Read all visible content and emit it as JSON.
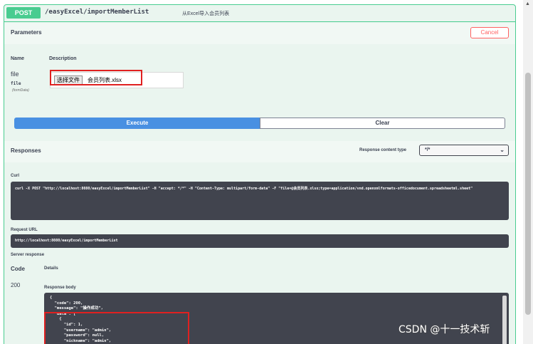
{
  "summary": {
    "method": "POST",
    "path": "/easyExcel/importMemberList",
    "description": "从Excel导入会员列表"
  },
  "parameters": {
    "title": "Parameters",
    "cancel_label": "Cancel",
    "col_name": "Name",
    "col_description": "Description",
    "param": {
      "name": "file",
      "type": "file",
      "in": "(formData)",
      "choose_label": "选择文件",
      "file_name": "会员列表.xlsx"
    },
    "execute_label": "Execute",
    "clear_label": "Clear"
  },
  "responses": {
    "title": "Responses",
    "content_type_label": "Response content type",
    "content_type_value": "*/*",
    "curl_label": "Curl",
    "curl_text": "curl -X POST \"http://localhost:8080/easyExcel/importMemberList\" -H \"accept: */*\" -H \"Content-Type: multipart/form-data\" -F \"file=@会员列表.xlsx;type=application/vnd.openxmlformats-officedocument.spreadsheetml.sheet\"",
    "request_url_label": "Request URL",
    "request_url": "http://localhost:8080/easyExcel/importMemberList",
    "server_response_label": "Server response",
    "code_header": "Code",
    "details_header": "Details",
    "code": "200",
    "response_body_label": "Response body",
    "response_body": "{\n  \"code\": 200,\n  \"message\": \"操作成功\",\n  \"data\": [\n    {\n      \"id\": 1,\n      \"username\": \"admin\",\n      \"password\": null,\n      \"nickname\": \"admin\","
  },
  "watermark": "CSDN @十一技术斩",
  "colors": {
    "post": "#49cc90",
    "execute": "#4990e2",
    "cancel": "#ff6060",
    "highlight": "#e02020",
    "code_bg": "#41444e"
  }
}
